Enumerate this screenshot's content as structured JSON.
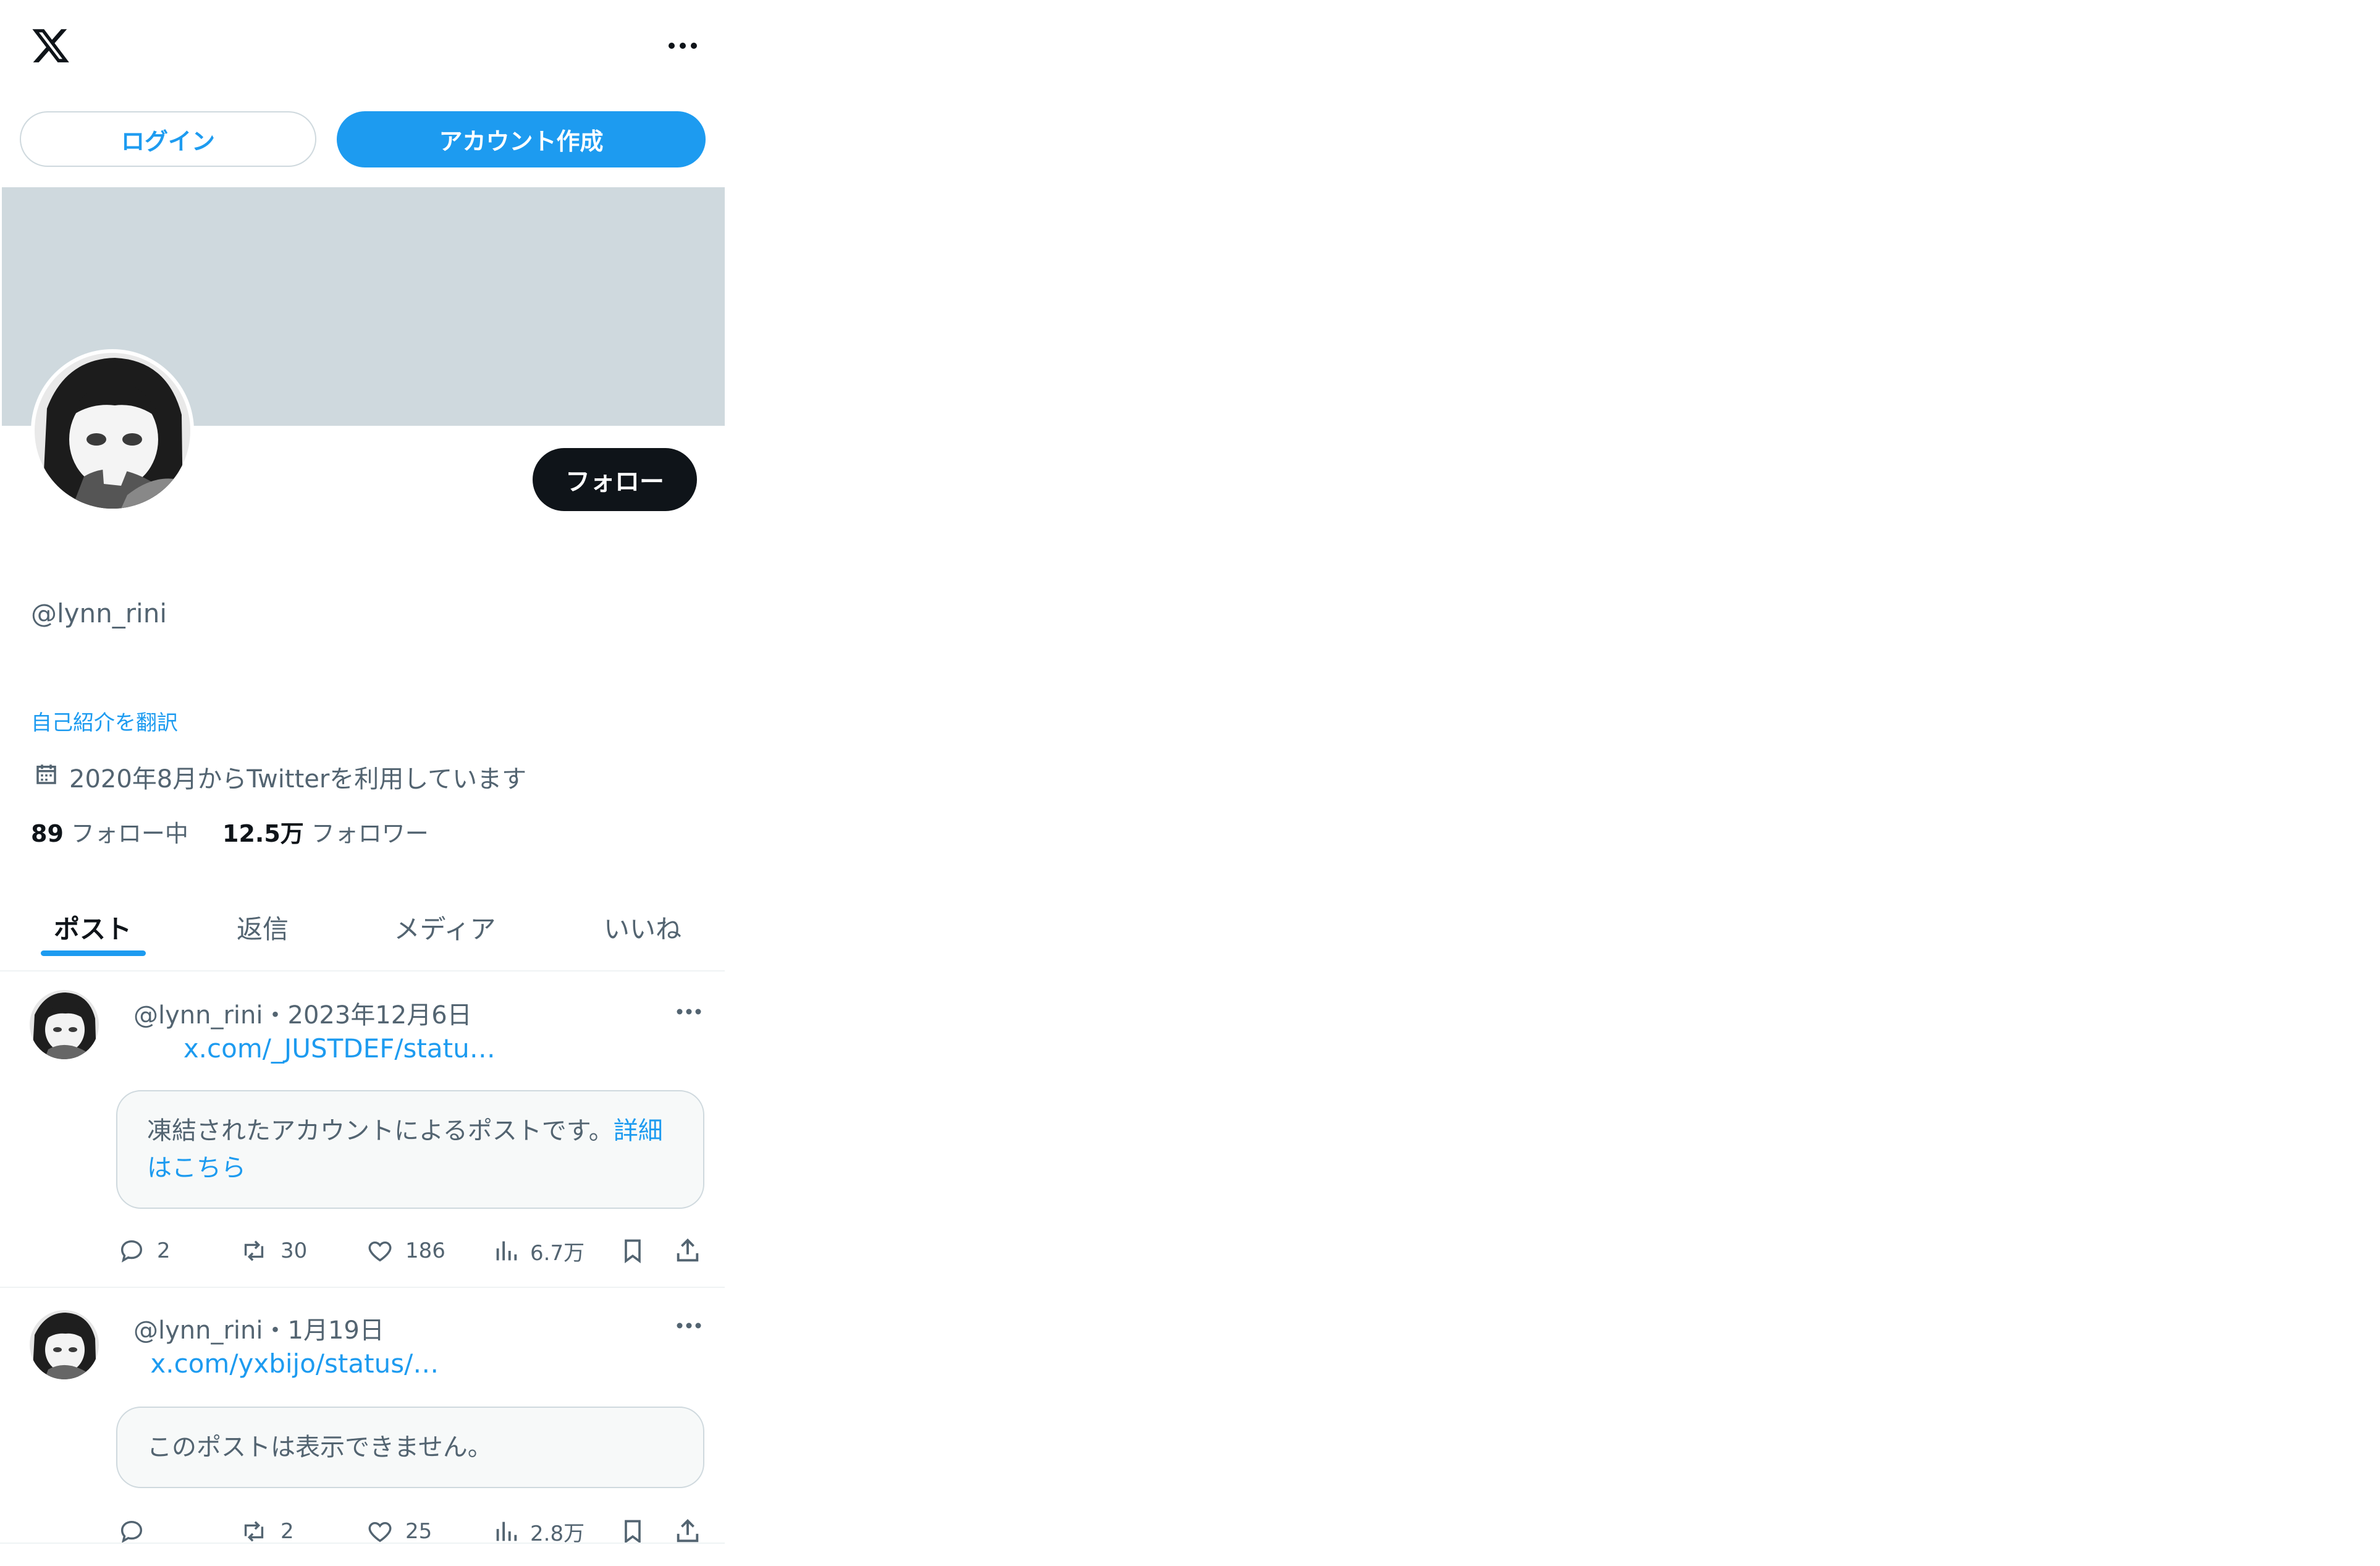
{
  "header": {
    "logo_icon": "x-logo-icon",
    "more_icon": "more-horizontal-icon"
  },
  "auth": {
    "login_label": "ログイン",
    "signup_label": "アカウント作成"
  },
  "profile": {
    "follow_label": "フォロー",
    "display_name": "",
    "handle": "@lynn_rini",
    "bio": "      ",
    "translate_bio": "自己紹介を翻訳",
    "joined": "2020年8月からTwitterを利用しています",
    "following_count": "89",
    "following_label": "フォロー中",
    "followers_count": "12.5万",
    "followers_label": "フォロワー"
  },
  "tabs": [
    {
      "label": "ポスト",
      "active": true
    },
    {
      "label": "返信",
      "active": false
    },
    {
      "label": "メディア",
      "active": false
    },
    {
      "label": "いいね",
      "active": false
    }
  ],
  "posts": [
    {
      "name": "",
      "handle": "@lynn_rini",
      "separator": "・",
      "date": "2023年12月6日",
      "text": "       ",
      "link": "x.com/_JUSTDEF/statu…",
      "quote_text": "凍結されたアカウントによるポストです。",
      "quote_link": "詳細はこちら",
      "replies": "2",
      "reposts": "30",
      "likes": "186",
      "views": "6.7万"
    },
    {
      "name": "",
      "handle": "@lynn_rini",
      "separator": "・",
      "date": "1月19日",
      "text": "   ",
      "link": "x.com/yxbijo/status/…",
      "quote_text": "このポストは表示できません。",
      "replies": "",
      "reposts": "2",
      "likes": "25",
      "views": "2.8万"
    }
  ],
  "colors": {
    "accent": "#1d9bf0",
    "text_primary": "#0f1419",
    "text_secondary": "#536471",
    "banner": "#cfd9de",
    "divider": "#eff3f4"
  }
}
